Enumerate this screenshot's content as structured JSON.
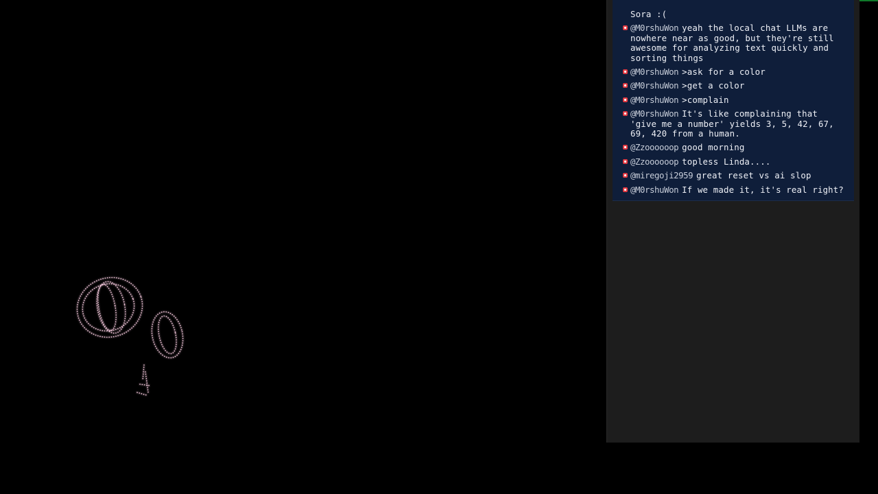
{
  "colors": {
    "accent_line": "#0f7a2a",
    "chat_bg": "#0f1e3a",
    "panel_bg": "#1d1d1d",
    "badge": "#e23a42",
    "art_dots": "#f4c8dc"
  },
  "stage": {
    "art_icon": "sparkle-dot-icon"
  },
  "chat": {
    "partial_text": "Sora :(",
    "messages": [
      {
        "user": "@M0rshuWon",
        "text": "yeah the local chat LLMs are nowhere near as good, but they're still awesome for analyzing text quickly and sorting things",
        "icon": "badge-icon"
      },
      {
        "user": "@M0rshuWon",
        "text": ">ask for a color",
        "icon": "badge-icon"
      },
      {
        "user": "@M0rshuWon",
        "text": ">get a color",
        "icon": "badge-icon"
      },
      {
        "user": "@M0rshuWon",
        "text": ">complain",
        "icon": "badge-icon"
      },
      {
        "user": "@M0rshuWon",
        "text": "It's like complaining that 'give me a number' yields 3, 5, 42, 67, 69, 420 from a human.",
        "icon": "badge-icon"
      },
      {
        "user": "@Zzoooooop",
        "text": "good morning",
        "icon": "badge-icon"
      },
      {
        "user": "@Zzoooooop",
        "text": "topless Linda....",
        "icon": "badge-icon"
      },
      {
        "user": "@miregoji2959",
        "text": "great reset vs ai slop",
        "icon": "badge-icon"
      },
      {
        "user": "@M0rshuWon",
        "text": "If we made it, it's real right?",
        "icon": "badge-icon"
      }
    ]
  }
}
